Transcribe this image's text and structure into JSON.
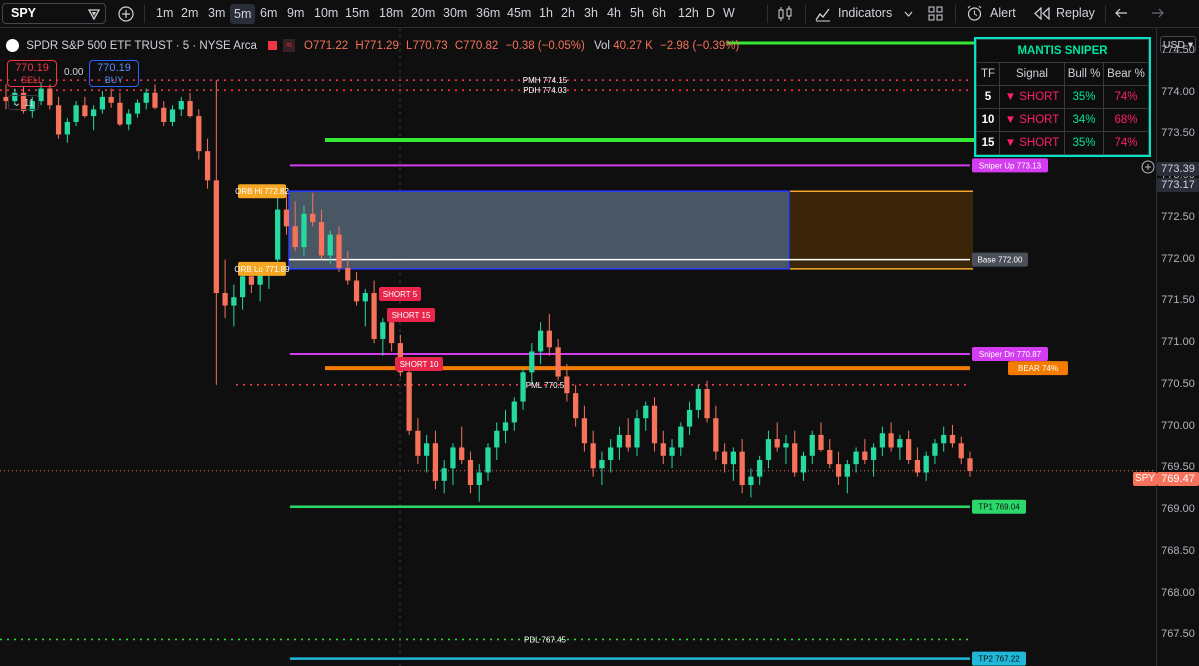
{
  "toolbar": {
    "symbol": "SPY",
    "timeframes": [
      "1m",
      "2m",
      "3m",
      "5m",
      "6m",
      "9m",
      "10m",
      "15m",
      "18m",
      "20m",
      "30m",
      "36m",
      "45m",
      "1h",
      "2h",
      "3h",
      "4h",
      "5h",
      "6h",
      "12h",
      "D",
      "W"
    ],
    "active_timeframe": "5m",
    "indicators_label": "Indicators",
    "alert_label": "Alert",
    "replay_label": "Replay"
  },
  "legend": {
    "title": "SPDR S&P 500 ETF TRUST · 5 · NYSE Arca",
    "open": "O771.22",
    "high": "H771.29",
    "low": "L770.73",
    "close": "C770.82",
    "change": "−0.38 (−0.05%)",
    "vol_label": "Vol",
    "vol": "40.27 K",
    "vol_change": "−2.98 (−0.39%)",
    "sell_price": "770.19",
    "sell_label": "SELL",
    "spread": "0.00",
    "buy_price": "770.19",
    "buy_label": "BUY",
    "indicator_count": "11"
  },
  "mantis": {
    "title": "MANTIS SNIPER",
    "headers": [
      "TF",
      "Signal",
      "Bull %",
      "Bear %"
    ],
    "rows": [
      {
        "tf": "5",
        "signal": "▼ SHORT",
        "bull": "35%",
        "bear": "74%"
      },
      {
        "tf": "10",
        "signal": "▼ SHORT",
        "bull": "34%",
        "bear": "68%"
      },
      {
        "tf": "15",
        "signal": "▼ SHORT",
        "bull": "35%",
        "bear": "74%"
      }
    ]
  },
  "axis": {
    "currency": "USD",
    "ticks": [
      "774.50",
      "774.00",
      "773.50",
      "773.00",
      "772.50",
      "772.00",
      "771.50",
      "771.00",
      "770.50",
      "770.00",
      "769.50",
      "769.00",
      "768.50",
      "768.00",
      "767.50"
    ],
    "price_label_1": "773.39",
    "price_label_2": "773.17",
    "last_symbol": "SPY",
    "last_price": "769.47"
  },
  "annotations": {
    "pmh": "PMH 774.15",
    "pdh": "PDH 774.03",
    "orb_hi": "ORB Hi 772.82",
    "orb_lo": "ORB Lo 771.89",
    "sniper_up": "Sniper Up 773.13",
    "base": "Base 772.00",
    "sniper_dn": "Sniper Dn 770.87",
    "bear": "BEAR 74%",
    "pml": "PML 770.5",
    "tp1": "TP1 769.04",
    "pdl": "PDL 767.45",
    "tp2": "TP2 767.22",
    "short5": "SHORT 5",
    "short15": "SHORT 15",
    "short10": "SHORT 10"
  },
  "colors": {
    "up": "#26d9a0",
    "down": "#f7725a",
    "mantis_border": "#00e5c5",
    "sniper": "#d33cf0",
    "green_line": "#34e834",
    "orange_line": "#f57c00",
    "red_dotted": "#f23645"
  },
  "chart_data": {
    "type": "candlestick",
    "symbol": "SPY",
    "interval": "5",
    "levels": [
      {
        "name": "PMH",
        "value": 774.15
      },
      {
        "name": "PDH",
        "value": 774.03
      },
      {
        "name": "Sniper Up",
        "value": 773.13
      },
      {
        "name": "ORB Hi",
        "value": 772.82
      },
      {
        "name": "Base",
        "value": 772.0
      },
      {
        "name": "ORB Lo",
        "value": 771.89
      },
      {
        "name": "Sniper Dn",
        "value": 770.87
      },
      {
        "name": "PML",
        "value": 770.5
      },
      {
        "name": "TP1",
        "value": 769.04
      },
      {
        "name": "PDL",
        "value": 767.45
      },
      {
        "name": "TP2",
        "value": 767.22
      }
    ],
    "ylim": [
      767.4,
      774.9
    ],
    "last_price": 769.47,
    "grid": false,
    "ohlc": [
      [
        773.95,
        774.1,
        773.8,
        773.9
      ],
      [
        773.9,
        774.05,
        773.85,
        774.0
      ],
      [
        774.0,
        774.08,
        773.75,
        773.78
      ],
      [
        773.78,
        773.95,
        773.7,
        773.9
      ],
      [
        773.9,
        774.12,
        773.85,
        774.05
      ],
      [
        774.05,
        774.1,
        773.8,
        773.85
      ],
      [
        773.85,
        773.95,
        773.45,
        773.5
      ],
      [
        773.5,
        773.7,
        773.4,
        773.65
      ],
      [
        773.65,
        773.9,
        773.6,
        773.85
      ],
      [
        773.85,
        773.95,
        773.7,
        773.72
      ],
      [
        773.72,
        773.85,
        773.55,
        773.8
      ],
      [
        773.8,
        774.02,
        773.75,
        773.95
      ],
      [
        773.95,
        774.05,
        773.82,
        773.88
      ],
      [
        773.88,
        774.0,
        773.6,
        773.62
      ],
      [
        773.62,
        773.8,
        773.55,
        773.75
      ],
      [
        773.75,
        773.92,
        773.7,
        773.88
      ],
      [
        773.88,
        774.05,
        773.8,
        774.0
      ],
      [
        774.0,
        774.1,
        773.8,
        773.82
      ],
      [
        773.82,
        773.9,
        773.6,
        773.65
      ],
      [
        773.65,
        773.85,
        773.6,
        773.8
      ],
      [
        773.8,
        773.95,
        773.72,
        773.9
      ],
      [
        773.9,
        774.0,
        773.7,
        773.72
      ],
      [
        773.72,
        773.8,
        773.2,
        773.3
      ],
      [
        773.3,
        773.45,
        772.85,
        772.95
      ],
      [
        772.95,
        774.15,
        770.5,
        771.6
      ],
      [
        771.6,
        772.0,
        771.3,
        771.45
      ],
      [
        771.45,
        771.7,
        771.2,
        771.55
      ],
      [
        771.55,
        771.9,
        771.4,
        771.8
      ],
      [
        771.8,
        771.95,
        771.6,
        771.7
      ],
      [
        771.7,
        771.92,
        771.5,
        771.85
      ],
      [
        771.85,
        771.95,
        771.65,
        771.9
      ],
      [
        772.0,
        772.85,
        771.9,
        772.6
      ],
      [
        772.6,
        772.82,
        772.3,
        772.4
      ],
      [
        772.4,
        772.7,
        772.1,
        772.15
      ],
      [
        772.15,
        772.65,
        772.05,
        772.55
      ],
      [
        772.55,
        772.8,
        772.4,
        772.45
      ],
      [
        772.45,
        772.6,
        772.0,
        772.05
      ],
      [
        772.05,
        772.35,
        771.95,
        772.3
      ],
      [
        772.3,
        772.4,
        771.85,
        771.9
      ],
      [
        771.9,
        772.1,
        771.7,
        771.75
      ],
      [
        771.75,
        771.85,
        771.45,
        771.5
      ],
      [
        771.5,
        771.65,
        771.2,
        771.6
      ],
      [
        771.6,
        771.75,
        771.0,
        771.05
      ],
      [
        771.05,
        771.3,
        770.85,
        771.25
      ],
      [
        771.25,
        771.35,
        770.9,
        771.0
      ],
      [
        771.0,
        771.1,
        770.6,
        770.65
      ],
      [
        770.65,
        770.75,
        769.9,
        769.95
      ],
      [
        769.95,
        770.1,
        769.55,
        769.65
      ],
      [
        769.65,
        769.9,
        769.45,
        769.8
      ],
      [
        769.8,
        769.95,
        769.25,
        769.35
      ],
      [
        769.35,
        769.6,
        769.2,
        769.5
      ],
      [
        769.5,
        769.8,
        769.3,
        769.75
      ],
      [
        769.75,
        770.0,
        769.55,
        769.6
      ],
      [
        769.6,
        769.7,
        769.2,
        769.3
      ],
      [
        769.3,
        769.55,
        769.1,
        769.45
      ],
      [
        769.45,
        769.8,
        769.35,
        769.75
      ],
      [
        769.75,
        770.05,
        769.6,
        769.95
      ],
      [
        769.95,
        770.2,
        769.8,
        770.05
      ],
      [
        770.05,
        770.35,
        769.95,
        770.3
      ],
      [
        770.3,
        770.7,
        770.2,
        770.65
      ],
      [
        770.65,
        771.0,
        770.5,
        770.9
      ],
      [
        770.9,
        771.25,
        770.75,
        771.15
      ],
      [
        771.15,
        771.35,
        770.85,
        770.95
      ],
      [
        770.95,
        771.05,
        770.55,
        770.6
      ],
      [
        770.6,
        770.75,
        770.3,
        770.4
      ],
      [
        770.4,
        770.5,
        770.0,
        770.1
      ],
      [
        770.1,
        770.25,
        769.7,
        769.8
      ],
      [
        769.8,
        769.95,
        769.4,
        769.5
      ],
      [
        769.5,
        769.7,
        769.3,
        769.6
      ],
      [
        769.6,
        769.85,
        769.45,
        769.75
      ],
      [
        769.75,
        770.0,
        769.6,
        769.9
      ],
      [
        769.9,
        770.1,
        769.7,
        769.75
      ],
      [
        769.75,
        770.2,
        769.65,
        770.1
      ],
      [
        770.1,
        770.3,
        769.95,
        770.25
      ],
      [
        770.25,
        770.35,
        769.7,
        769.8
      ],
      [
        769.8,
        769.95,
        769.55,
        769.65
      ],
      [
        769.65,
        769.85,
        769.5,
        769.75
      ],
      [
        769.75,
        770.05,
        769.65,
        770.0
      ],
      [
        770.0,
        770.3,
        769.9,
        770.2
      ],
      [
        770.2,
        770.5,
        770.1,
        770.45
      ],
      [
        770.45,
        770.55,
        770.05,
        770.1
      ],
      [
        770.1,
        770.25,
        769.6,
        769.7
      ],
      [
        769.7,
        769.8,
        769.45,
        769.55
      ],
      [
        769.55,
        769.75,
        769.35,
        769.7
      ],
      [
        769.7,
        769.85,
        769.2,
        769.3
      ],
      [
        769.3,
        769.5,
        769.15,
        769.4
      ],
      [
        769.4,
        769.65,
        769.3,
        769.6
      ],
      [
        769.6,
        769.95,
        769.5,
        769.85
      ],
      [
        769.85,
        770.05,
        769.7,
        769.75
      ],
      [
        769.75,
        769.9,
        769.55,
        769.8
      ],
      [
        769.8,
        769.95,
        769.4,
        769.45
      ],
      [
        769.45,
        769.7,
        769.35,
        769.65
      ],
      [
        769.65,
        769.95,
        769.55,
        769.9
      ],
      [
        769.9,
        770.05,
        769.7,
        769.72
      ],
      [
        769.72,
        769.85,
        769.5,
        769.55
      ],
      [
        769.55,
        769.7,
        769.3,
        769.4
      ],
      [
        769.4,
        769.6,
        769.2,
        769.55
      ],
      [
        769.55,
        769.75,
        769.45,
        769.7
      ],
      [
        769.7,
        769.85,
        769.55,
        769.6
      ],
      [
        769.6,
        769.8,
        769.4,
        769.75
      ],
      [
        769.75,
        770.0,
        769.65,
        769.92
      ],
      [
        769.92,
        770.05,
        769.7,
        769.75
      ],
      [
        769.75,
        769.9,
        769.6,
        769.85
      ],
      [
        769.85,
        769.95,
        769.55,
        769.6
      ],
      [
        769.6,
        769.75,
        769.4,
        769.45
      ],
      [
        769.45,
        769.7,
        769.35,
        769.65
      ],
      [
        769.65,
        769.85,
        769.55,
        769.8
      ],
      [
        769.8,
        770.0,
        769.7,
        769.9
      ],
      [
        769.9,
        770.02,
        769.75,
        769.8
      ],
      [
        769.8,
        769.88,
        769.55,
        769.62
      ],
      [
        769.62,
        769.7,
        769.4,
        769.47
      ]
    ]
  }
}
